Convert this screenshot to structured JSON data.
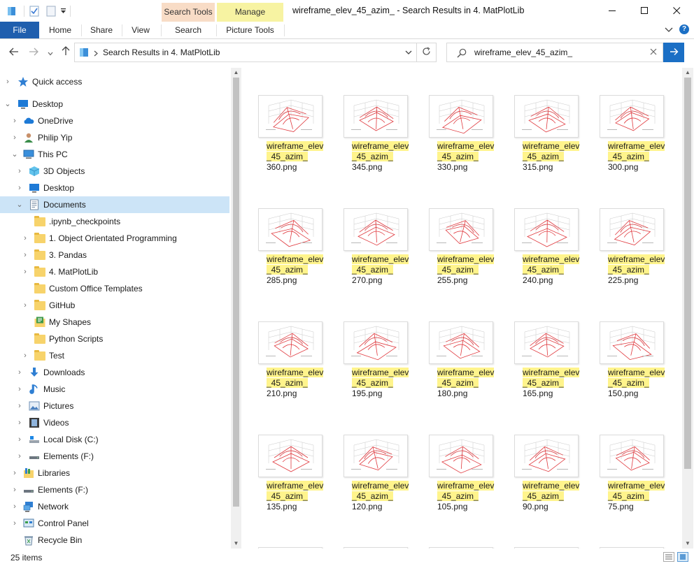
{
  "titlebar": {
    "window_title": "wireframe_elev_45_azim_ - Search Results in 4. MatPlotLib",
    "context_tabs": [
      "Search Tools",
      "Manage"
    ],
    "minimize_icon": "minimize-icon",
    "maximize_icon": "maximize-icon",
    "close_icon": "close-icon"
  },
  "ribbon": {
    "tabs": [
      "File",
      "Home",
      "Share",
      "View",
      "Search",
      "Picture Tools"
    ],
    "file_color": "#1f5fae"
  },
  "addressbar": {
    "path": "Search Results in 4. MatPlotLib",
    "search_query": "wireframe_elev_45_azim_"
  },
  "navpane": {
    "items": [
      {
        "label": "Quick access",
        "icon": "star-icon"
      },
      {
        "label": "Desktop",
        "icon": "desktop-icon"
      },
      {
        "label": "OneDrive",
        "icon": "cloud-icon"
      },
      {
        "label": "Philip Yip",
        "icon": "user-icon"
      },
      {
        "label": "This PC",
        "icon": "computer-icon"
      },
      {
        "label": "3D Objects",
        "icon": "cube-icon"
      },
      {
        "label": "Desktop",
        "icon": "desktop-icon"
      },
      {
        "label": "Documents",
        "icon": "document-icon"
      },
      {
        "label": ".ipynb_checkpoints",
        "icon": "folder-icon"
      },
      {
        "label": "1. Object Orientated Programming",
        "icon": "folder-icon"
      },
      {
        "label": "3. Pandas",
        "icon": "folder-icon"
      },
      {
        "label": "4. MatPlotLib",
        "icon": "folder-icon"
      },
      {
        "label": "Custom Office Templates",
        "icon": "folder-icon"
      },
      {
        "label": "GitHub",
        "icon": "folder-icon"
      },
      {
        "label": "My Shapes",
        "icon": "shapes-folder-icon"
      },
      {
        "label": "Python Scripts",
        "icon": "folder-icon"
      },
      {
        "label": "Test",
        "icon": "folder-icon"
      },
      {
        "label": "Downloads",
        "icon": "download-icon"
      },
      {
        "label": "Music",
        "icon": "music-icon"
      },
      {
        "label": "Pictures",
        "icon": "pictures-icon"
      },
      {
        "label": "Videos",
        "icon": "videos-icon"
      },
      {
        "label": "Local Disk (C:)",
        "icon": "disk-icon"
      },
      {
        "label": "Elements (F:)",
        "icon": "drive-icon"
      },
      {
        "label": "Libraries",
        "icon": "library-icon"
      },
      {
        "label": "Elements (F:)",
        "icon": "drive-icon"
      },
      {
        "label": "Network",
        "icon": "network-icon"
      },
      {
        "label": "Control Panel",
        "icon": "control-panel-icon"
      },
      {
        "label": "Recycle Bin",
        "icon": "recycle-bin-icon"
      }
    ]
  },
  "files": [
    {
      "hl1": "wireframe_elev",
      "hl2": "_45_azim_",
      "rest": "360.png"
    },
    {
      "hl1": "wireframe_elev",
      "hl2": "_45_azim_",
      "rest": "345.png"
    },
    {
      "hl1": "wireframe_elev",
      "hl2": "_45_azim_",
      "rest": "330.png"
    },
    {
      "hl1": "wireframe_elev",
      "hl2": "_45_azim_",
      "rest": "315.png"
    },
    {
      "hl1": "wireframe_elev",
      "hl2": "_45_azim_",
      "rest": "300.png"
    },
    {
      "hl1": "wireframe_elev",
      "hl2": "_45_azim_",
      "rest": "285.png"
    },
    {
      "hl1": "wireframe_elev",
      "hl2": "_45_azim_",
      "rest": "270.png"
    },
    {
      "hl1": "wireframe_elev",
      "hl2": "_45_azim_",
      "rest": "255.png"
    },
    {
      "hl1": "wireframe_elev",
      "hl2": "_45_azim_",
      "rest": "240.png"
    },
    {
      "hl1": "wireframe_elev",
      "hl2": "_45_azim_",
      "rest": "225.png"
    },
    {
      "hl1": "wireframe_elev",
      "hl2": "_45_azim_",
      "rest": "210.png"
    },
    {
      "hl1": "wireframe_elev",
      "hl2": "_45_azim_",
      "rest": "195.png"
    },
    {
      "hl1": "wireframe_elev",
      "hl2": "_45_azim_",
      "rest": "180.png"
    },
    {
      "hl1": "wireframe_elev",
      "hl2": "_45_azim_",
      "rest": "165.png"
    },
    {
      "hl1": "wireframe_elev",
      "hl2": "_45_azim_",
      "rest": "150.png"
    },
    {
      "hl1": "wireframe_elev",
      "hl2": "_45_azim_",
      "rest": "135.png"
    },
    {
      "hl1": "wireframe_elev",
      "hl2": "_45_azim_",
      "rest": "120.png"
    },
    {
      "hl1": "wireframe_elev",
      "hl2": "_45_azim_",
      "rest": "105.png"
    },
    {
      "hl1": "wireframe_elev",
      "hl2": "_45_azim_",
      "rest": "90.png"
    },
    {
      "hl1": "wireframe_elev",
      "hl2": "_45_azim_",
      "rest": "75.png"
    }
  ],
  "status": {
    "item_count": "25 items"
  },
  "colors": {
    "highlight": "#fff48c",
    "wireframe": "#e0393e",
    "selection": "#cce4f7",
    "accent": "#1b6fc5"
  }
}
